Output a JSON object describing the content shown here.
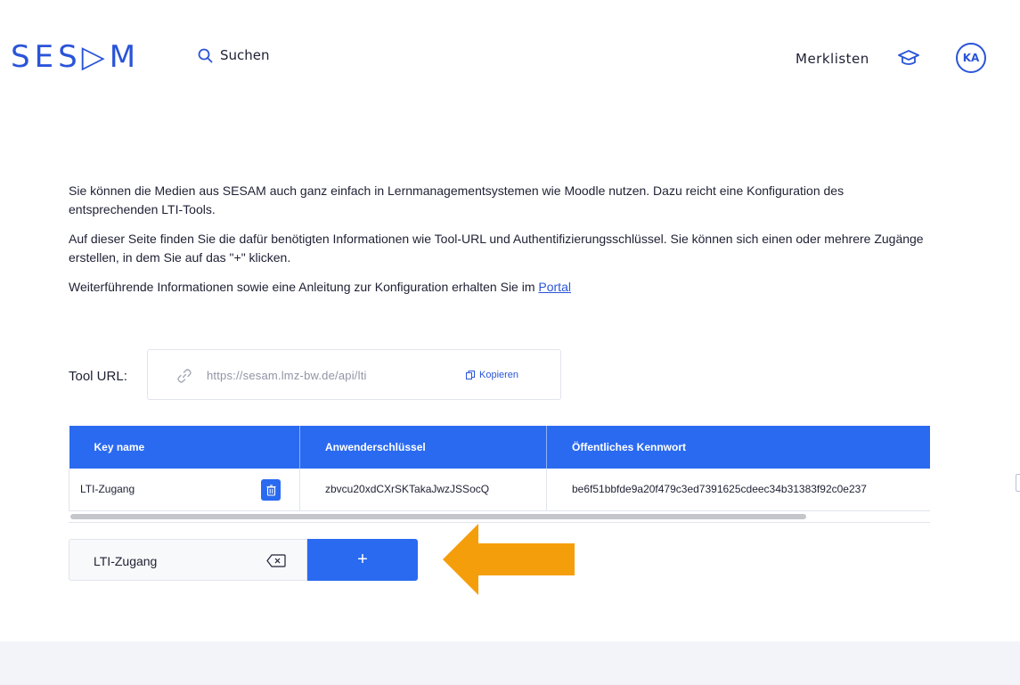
{
  "header": {
    "logo_text": "SES▷M",
    "search_label": "Suchen",
    "merklisten_label": "Merklisten",
    "avatar_initials": "KA"
  },
  "intro": {
    "p1": "Sie können die Medien aus SESAM auch ganz einfach in Lernmanagementsystemen wie Moodle nutzen. Dazu reicht eine Konfiguration des entsprechenden LTI-Tools.",
    "p2": "Auf dieser Seite finden Sie die dafür benötigten Informationen wie Tool-URL und Authentifizierungsschlüssel. Sie können sich einen oder mehrere Zugänge erstellen, in dem Sie auf das \"+\" klicken.",
    "p3_text": "Weiterführende Informationen sowie eine Anleitung zur Konfiguration erhalten Sie im ",
    "p3_link": "Portal"
  },
  "tool_url": {
    "label": "Tool URL:",
    "value": "https://sesam.lmz-bw.de/api/lti",
    "copy_label": "Kopieren"
  },
  "table": {
    "columns": [
      "Key name",
      "Anwenderschlüssel",
      "Öffentliches Kennwort"
    ],
    "rows": [
      [
        "LTI-Zugang",
        "zbvcu20xdCXrSKTakaJwzJSSocQ",
        "be6f51bbfde9a20f479c3ed7391625cdeec34b31383f92c0e237"
      ]
    ]
  },
  "new_key": {
    "value": "LTI-Zugang",
    "add_label": "+"
  },
  "colors": {
    "accent": "#2a6af0",
    "logo": "#2a54d8",
    "arrow": "#f59e0b"
  }
}
